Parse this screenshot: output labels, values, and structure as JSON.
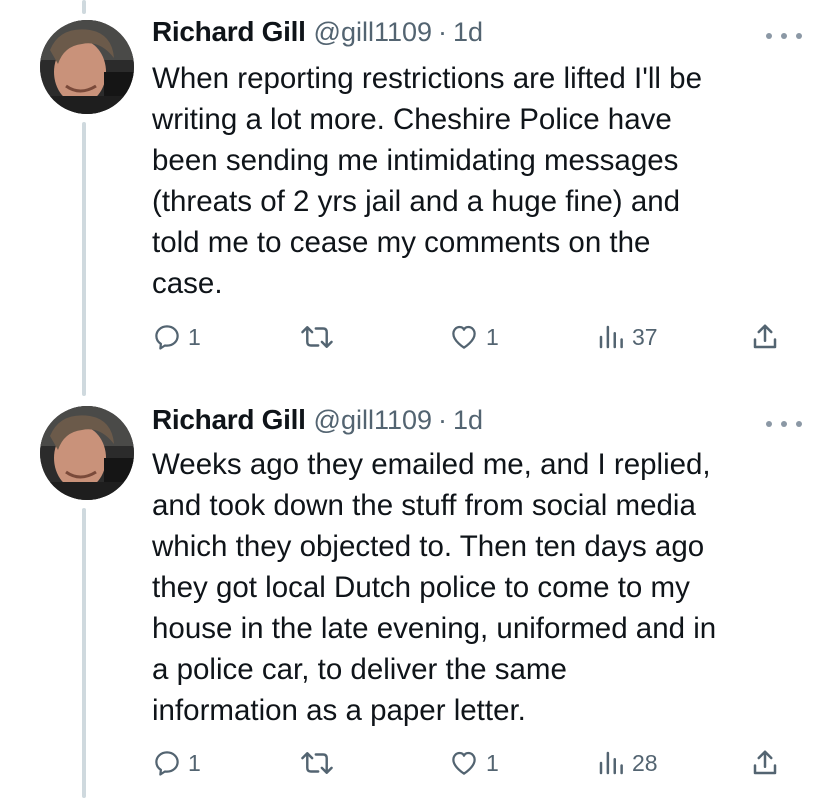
{
  "tweets": [
    {
      "author_name": "Richard Gill",
      "handle": "@gill1109",
      "separator": "·",
      "time": "1d",
      "text": "When reporting restrictions are lifted I'll be\nwriting a lot more. Cheshire Police have\nbeen sending me intimidating messages\n(threats of 2 yrs jail and a huge fine) and\ntold me to cease my comments on the\ncase.",
      "replies": "1",
      "retweets": "",
      "likes": "1",
      "views": "37",
      "icons": {
        "reply": "reply-icon",
        "retweet": "retweet-icon",
        "like": "heart-icon",
        "views": "views-chart-icon",
        "share": "share-icon",
        "more": "more-options-icon"
      }
    },
    {
      "author_name": "Richard Gill",
      "handle": "@gill1109",
      "separator": "·",
      "time": "1d",
      "text": "Weeks ago they emailed me, and I replied,\nand took down the stuff from social media\nwhich they objected to. Then ten days ago\nthey got local Dutch police to come to my\nhouse in the late evening, uniformed and in\na police car, to deliver the same\ninformation as a paper letter.",
      "replies": "1",
      "retweets": "",
      "likes": "1",
      "views": "28",
      "icons": {
        "reply": "reply-icon",
        "retweet": "retweet-icon",
        "like": "heart-icon",
        "views": "views-chart-icon",
        "share": "share-icon",
        "more": "more-options-icon"
      }
    }
  ],
  "colors": {
    "text": "#0f1419",
    "secondary": "#536471",
    "thread_line": "#cfd9de",
    "background": "#ffffff"
  }
}
